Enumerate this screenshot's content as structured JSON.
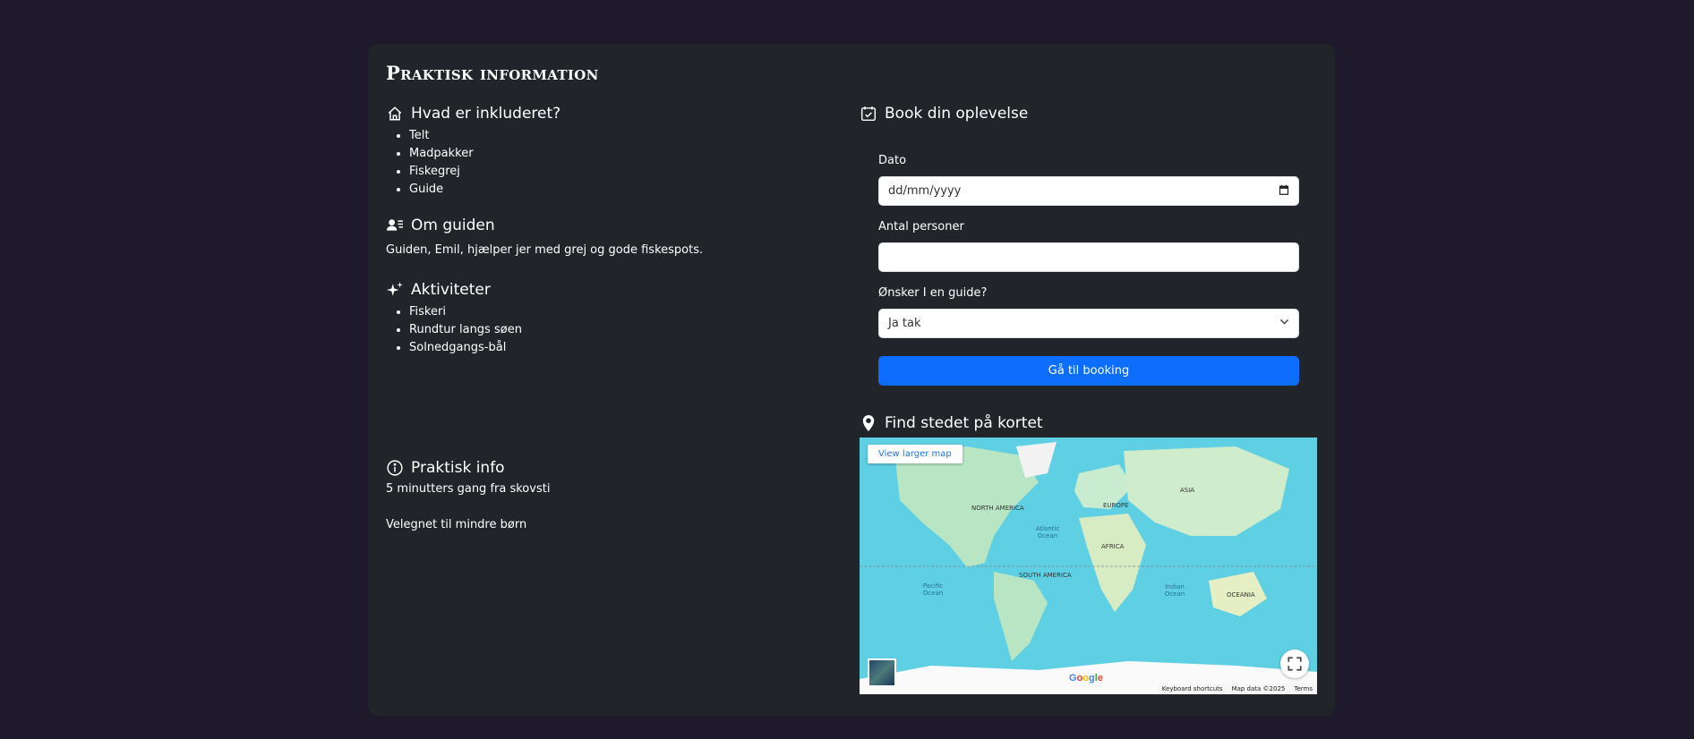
{
  "card": {
    "title": "Praktisk information"
  },
  "included": {
    "heading": "Hvad er inkluderet?",
    "items": [
      "Telt",
      "Madpakker",
      "Fiskegrej",
      "Guide"
    ]
  },
  "guide": {
    "heading": "Om guiden",
    "text": "Guiden, Emil, hjælper jer med grej og gode fiskespots."
  },
  "activities": {
    "heading": "Aktiviteter",
    "items": [
      "Fiskeri",
      "Rundtur langs søen",
      "Solnedgangs-bål"
    ]
  },
  "practical": {
    "heading": "Praktisk info",
    "lines": [
      "5 minutters gang fra skovsti",
      "Velegnet til mindre børn"
    ]
  },
  "booking": {
    "heading": "Book din oplevelse",
    "date_label": "Dato",
    "date_placeholder": "dd/mm/yyyy",
    "persons_label": "Antal personer",
    "persons_value": "",
    "guide_label": "Ønsker I en guide?",
    "guide_selected": "Ja tak",
    "submit_label": "Gå til booking"
  },
  "map": {
    "heading": "Find stedet på kortet",
    "view_larger": "View larger map",
    "google": "Google",
    "keyboard": "Keyboard shortcuts",
    "map_data": "Map data ©2025",
    "terms": "Terms",
    "labels": {
      "north_america": "NORTH AMERICA",
      "south_america": "SOUTH AMERICA",
      "europe": "EUROPE",
      "asia": "ASIA",
      "africa": "AFRICA",
      "oceania": "OCEANIA",
      "atlantic": "Atlantic Ocean",
      "pacific": "Pacific Ocean",
      "indian": "Indian Ocean"
    }
  },
  "colors": {
    "page_bg": "#1f1a2b",
    "card_bg": "#212529",
    "primary": "#0d6efd",
    "map_water": "#5fd0e3",
    "map_land": "#b8e6c4"
  }
}
